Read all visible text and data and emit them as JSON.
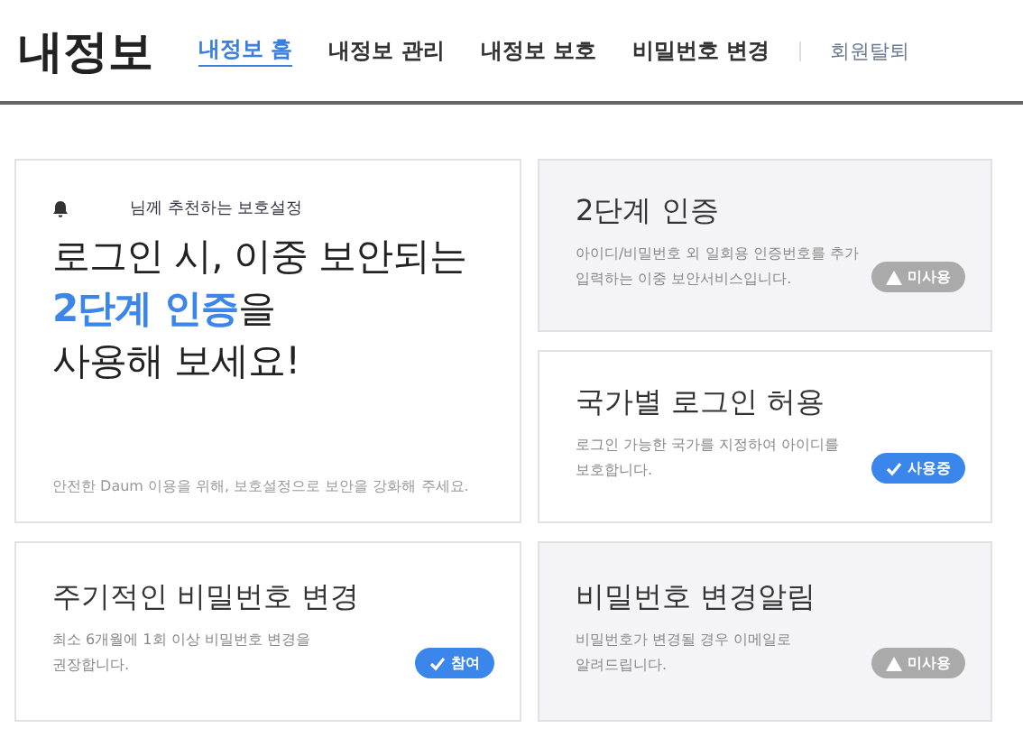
{
  "header": {
    "title": "내정보",
    "nav": [
      {
        "label": "내정보 홈",
        "selected": true
      },
      {
        "label": "내정보 관리",
        "selected": false
      },
      {
        "label": "내정보 보호",
        "selected": false
      },
      {
        "label": "비밀번호 변경",
        "selected": false
      }
    ],
    "withdraw_link": "회원탈퇴"
  },
  "hero": {
    "eyebrow": "님께 추천하는 보호설정",
    "headline": [
      [
        {
          "text": "로그인 시, 이중 보안되는",
          "highlight": false
        }
      ],
      [
        {
          "text": "2단계 인증",
          "highlight": true
        },
        {
          "text": "을",
          "highlight": false
        }
      ],
      [
        {
          "text": "사용해 보세요!",
          "highlight": false
        }
      ]
    ],
    "note": "안전한 Daum 이용을 위해, 보호설정으로 보안을 강화해 주세요."
  },
  "cards": [
    {
      "title": "2단계 인증",
      "description": "아이디/비밀번호 외 일회용 인증번호를 추가 입력하는 이중 보안서비스입니다.",
      "badge": "미사용",
      "active": false
    },
    {
      "title": "국가별 로그인 허용",
      "description": "로그인 가능한 국가를 지정하여 아이디를 보호합니다.",
      "badge": "사용중",
      "active": true
    },
    {
      "title": "주기적인 비밀번호 변경",
      "description": "최소 6개월에 1회 이상 비밀번호 변경을 권장합니다.",
      "badge": "참여",
      "active": true
    },
    {
      "title": "비밀번호 변경알림",
      "description": "비밀번호가 변경될 경우 이메일로 알려드립니다.",
      "badge": "미사용",
      "active": false
    }
  ]
}
